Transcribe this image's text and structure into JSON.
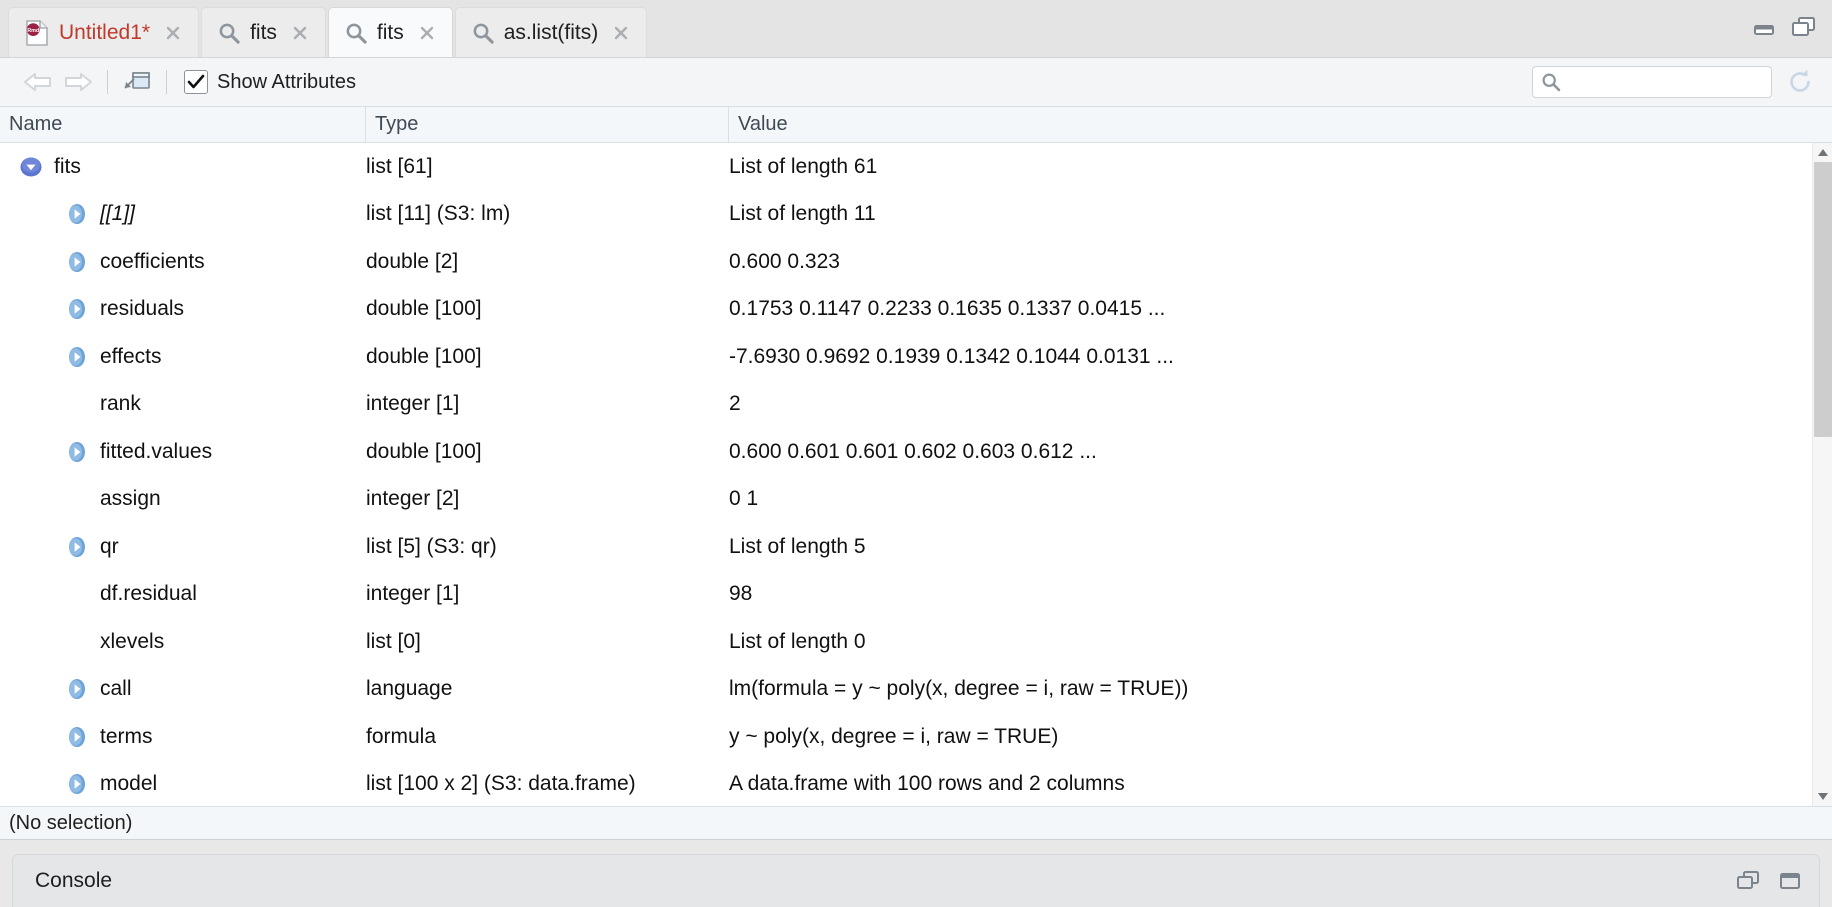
{
  "window": {
    "minimize_icon": "minimize-icon",
    "restore_icon": "restore-icon"
  },
  "tabs": [
    {
      "label": "Untitled1*",
      "icon": "rmd-file-icon",
      "active": false,
      "modified": true,
      "close_icon": "close-icon"
    },
    {
      "label": "fits",
      "icon": "search-icon",
      "active": false,
      "modified": false,
      "close_icon": "close-icon"
    },
    {
      "label": "fits",
      "icon": "search-icon",
      "active": true,
      "modified": false,
      "close_icon": "close-icon"
    },
    {
      "label": "as.list(fits)",
      "icon": "search-icon",
      "active": false,
      "modified": false,
      "close_icon": "close-icon"
    }
  ],
  "toolbar": {
    "back_icon": "back-arrow-icon",
    "forward_icon": "forward-arrow-icon",
    "open_new_window_icon": "open-in-new-window-icon",
    "show_attributes_label": "Show Attributes",
    "show_attributes_checked": true,
    "search_placeholder": "",
    "search_value": "",
    "search_icon": "search-icon",
    "refresh_icon": "refresh-icon"
  },
  "grid": {
    "columns": [
      "Name",
      "Type",
      "Value"
    ],
    "rows": [
      {
        "name": "fits",
        "type": "list [61]",
        "value": "List of length 61",
        "depth": 0,
        "expander": "expanded",
        "italic": false
      },
      {
        "name": "[[1]]",
        "type": "list [11] (S3: lm)",
        "value": "List of length 11",
        "depth": 1,
        "expander": "collapsed",
        "italic": true
      },
      {
        "name": "coefficients",
        "type": "double [2]",
        "value": "0.600 0.323",
        "depth": 1,
        "expander": "collapsed",
        "italic": false
      },
      {
        "name": "residuals",
        "type": "double [100]",
        "value": "0.1753 0.1147 0.2233 0.1635 0.1337 0.0415 ...",
        "depth": 1,
        "expander": "collapsed",
        "italic": false
      },
      {
        "name": "effects",
        "type": "double [100]",
        "value": "-7.6930 0.9692 0.1939 0.1342 0.1044 0.0131 ...",
        "depth": 1,
        "expander": "collapsed",
        "italic": false
      },
      {
        "name": "rank",
        "type": "integer [1]",
        "value": "2",
        "depth": 1,
        "expander": "none",
        "italic": false
      },
      {
        "name": "fitted.values",
        "type": "double [100]",
        "value": "0.600 0.601 0.601 0.602 0.603 0.612 ...",
        "depth": 1,
        "expander": "collapsed",
        "italic": false
      },
      {
        "name": "assign",
        "type": "integer [2]",
        "value": "0 1",
        "depth": 1,
        "expander": "none",
        "italic": false
      },
      {
        "name": "qr",
        "type": "list [5] (S3: qr)",
        "value": "List of length 5",
        "depth": 1,
        "expander": "collapsed",
        "italic": false
      },
      {
        "name": "df.residual",
        "type": "integer [1]",
        "value": "98",
        "depth": 1,
        "expander": "none",
        "italic": false
      },
      {
        "name": "xlevels",
        "type": "list [0]",
        "value": "List of length 0",
        "depth": 1,
        "expander": "none",
        "italic": false
      },
      {
        "name": "call",
        "type": "language",
        "value": "lm(formula = y ~ poly(x, degree = i, raw = TRUE))",
        "depth": 1,
        "expander": "collapsed",
        "italic": false
      },
      {
        "name": "terms",
        "type": "formula",
        "value": "y ~ poly(x, degree = i, raw = TRUE)",
        "depth": 1,
        "expander": "collapsed",
        "italic": false
      },
      {
        "name": "model",
        "type": "list [100 x 2] (S3: data.frame)",
        "value": "A data.frame with 100 rows and 2 columns",
        "depth": 1,
        "expander": "collapsed",
        "italic": false
      }
    ]
  },
  "scrollbar": {
    "up_icon": "scroll-up-arrow-icon",
    "down_icon": "scroll-down-arrow-icon",
    "thumb_top_percent": 0,
    "thumb_height_percent": 44
  },
  "statusbar": {
    "text": "(No selection)"
  },
  "console": {
    "title": "Console",
    "restore_icon": "restore-pane-icon",
    "maximize_icon": "maximize-pane-icon"
  },
  "colors": {
    "tab_active_bg": "#f9fafb",
    "tab_inactive_bg": "#ececec",
    "modified_label": "#c0392b",
    "expander_expanded": "#4a6fd4",
    "expander_collapsed": "#7aabdd",
    "toolbar_bg": "#f3f5f7",
    "grid_header_bg": "#f4f7f9",
    "console_bg": "#e4e6e8",
    "scrollbar_thumb": "#cdcdcd"
  }
}
